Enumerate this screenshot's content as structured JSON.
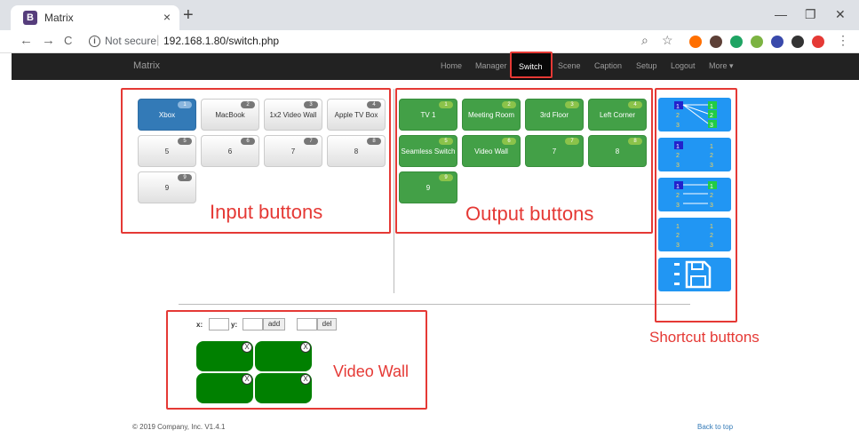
{
  "browser": {
    "tab_title": "Matrix",
    "tab_favicon": "B",
    "close_tab": "×",
    "new_tab": "+",
    "minimize": "—",
    "restore": "❐",
    "close_window": "✕",
    "back": "←",
    "forward": "→",
    "reload": "C",
    "info": "i",
    "not_secure": "Not secure",
    "separator": "|",
    "url": "192.168.1.80/switch.php",
    "zoom_icon": "⌕",
    "star_icon": "☆",
    "menu_icon": "⋮",
    "extension_colors": [
      "#ff6f00",
      "#5d4037",
      "#1fa463",
      "#7cb342",
      "#3949ab",
      "#333333",
      "#e53935"
    ]
  },
  "navbar": {
    "brand": "Matrix",
    "items": [
      {
        "label": "Home"
      },
      {
        "label": "Manager"
      },
      {
        "label": "Switch"
      },
      {
        "label": "Scene"
      },
      {
        "label": "Caption"
      },
      {
        "label": "Setup"
      },
      {
        "label": "Logout"
      },
      {
        "label": "More ▾"
      }
    ]
  },
  "inputs": [
    {
      "num": "1",
      "label": "Xbox",
      "selected": true
    },
    {
      "num": "2",
      "label": "MacBook"
    },
    {
      "num": "3",
      "label": "1x2 Video Wall"
    },
    {
      "num": "4",
      "label": "Apple TV Box"
    },
    {
      "num": "5",
      "label": "5"
    },
    {
      "num": "6",
      "label": "6"
    },
    {
      "num": "7",
      "label": "7"
    },
    {
      "num": "8",
      "label": "8"
    },
    {
      "num": "9",
      "label": "9"
    }
  ],
  "outputs": [
    {
      "num": "1",
      "label": "TV 1"
    },
    {
      "num": "2",
      "label": "Meeting Room"
    },
    {
      "num": "3",
      "label": "3rd Floor"
    },
    {
      "num": "4",
      "label": "Left Corner"
    },
    {
      "num": "5",
      "label": "Seamless Switch"
    },
    {
      "num": "6",
      "label": "Video Wall"
    },
    {
      "num": "7",
      "label": "7"
    },
    {
      "num": "8",
      "label": "8"
    },
    {
      "num": "9",
      "label": "9"
    }
  ],
  "shortcut_numbers": [
    "1",
    "2",
    "3"
  ],
  "annotations": {
    "input": "Input buttons",
    "output": "Output buttons",
    "shortcut": "Shortcut buttons",
    "video_wall": "Video Wall"
  },
  "video_wall": {
    "x_label": "x:",
    "y_label": "y:",
    "add_label": "add",
    "del_label": "del",
    "remove_glyph": "X"
  },
  "footer": {
    "copyright": "© 2019 Company, Inc. V1.4.1",
    "back_to_top": "Back to top"
  }
}
